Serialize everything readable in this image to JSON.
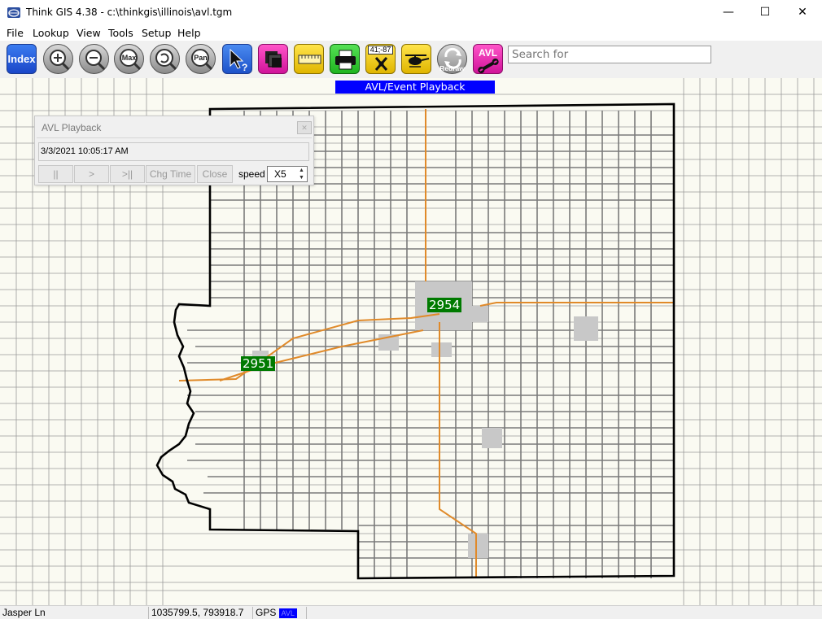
{
  "window": {
    "title": "Think GIS 4.38 - c:\\thinkgis\\illinois\\avl.tgm",
    "minimize_glyph": "—",
    "maximize_glyph": "☐",
    "close_glyph": "✕"
  },
  "menu": [
    "File",
    "Lookup",
    "View",
    "Tools",
    "Setup",
    "Help"
  ],
  "toolbar": {
    "index_label": "Index",
    "max_label": "Max",
    "pan_label": "Pan",
    "coords_label": "41;-87",
    "redraw_label": "Redraw",
    "avl_label": "AVL",
    "search_placeholder": "Search for"
  },
  "map": {
    "banner": "AVL/Event Playback",
    "units": [
      {
        "id": "2954"
      },
      {
        "id": "2951"
      }
    ],
    "colors": {
      "background": "#fafaf2",
      "road": "#808080",
      "highway": "#e08a2a",
      "border": "#000000",
      "unit_label": "#007a00",
      "banner": "#0000ff"
    }
  },
  "dialog": {
    "title": "AVL Playback",
    "timestamp": "3/3/2021 10:05:17 AM",
    "btn_pause": "||",
    "btn_play": ">",
    "btn_end": ">||",
    "btn_chg_time": "Chg Time",
    "btn_close": "Close",
    "speed_label": "speed",
    "speed_value": "X5"
  },
  "status": {
    "street": "Jasper Ln",
    "coords": "1035799.5, 793918.7",
    "gps_label": "GPS",
    "gps_indicator": "AVL"
  }
}
